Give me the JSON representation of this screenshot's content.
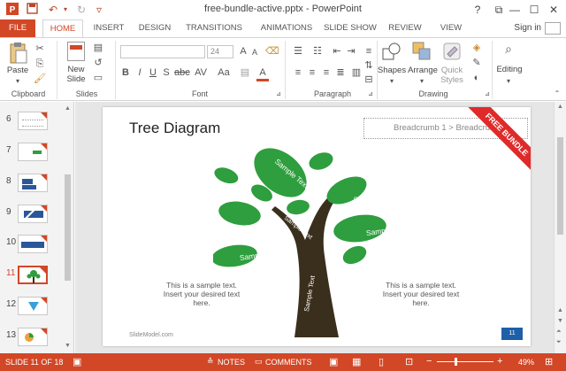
{
  "window": {
    "title": "free-bundle-active.pptx - PowerPoint"
  },
  "quick_access": {
    "save_icon": "save-icon",
    "undo_icon": "undo-icon",
    "redo_icon": "redo-icon",
    "customize_icon": "customize-icon"
  },
  "window_controls": {
    "help": "?",
    "restore": "⧉",
    "minimize": "—",
    "maximize": "☐",
    "close": "✕"
  },
  "tabs": [
    "FILE",
    "HOME",
    "INSERT",
    "DESIGN",
    "TRANSITIONS",
    "ANIMATIONS",
    "SLIDE SHOW",
    "REVIEW",
    "VIEW"
  ],
  "active_tab": "HOME",
  "sign_in": "Sign in",
  "ribbon": {
    "clipboard": {
      "paste": "Paste",
      "label": "Clipboard"
    },
    "slides": {
      "new_slide": "New",
      "new_slide2": "Slide",
      "label": "Slides"
    },
    "font": {
      "size": "24",
      "label": "Font"
    },
    "paragraph": {
      "label": "Paragraph"
    },
    "drawing": {
      "shapes": "Shapes",
      "arrange": "Arrange",
      "quick_styles": "Quick",
      "quick_styles2": "Styles",
      "label": "Drawing"
    },
    "editing": {
      "label": "Editing"
    }
  },
  "thumbnails": [
    {
      "num": "6"
    },
    {
      "num": "7"
    },
    {
      "num": "8"
    },
    {
      "num": "9"
    },
    {
      "num": "10"
    },
    {
      "num": "11",
      "selected": true
    },
    {
      "num": "12"
    },
    {
      "num": "13"
    }
  ],
  "slide": {
    "title": "Tree Diagram",
    "breadcrumb": "Breadcrumb 1 > Breadcrumb",
    "ribbon_text": "FREE BUNDLE",
    "leaves": [
      "Sample Text",
      "Sample Text",
      "Sample Text",
      "Sample Text"
    ],
    "branch_text": "Sample Text",
    "trunk_text": "Sample Text",
    "left_text": [
      "This is a sample text.",
      "Insert your desired text",
      "here."
    ],
    "right_text": [
      "This is a sample text.",
      "Insert your desired text",
      "here."
    ],
    "footer": "SlideModel.com",
    "page_num": "11"
  },
  "status": {
    "slide_info": "SLIDE 11 OF 18",
    "notes": "NOTES",
    "comments": "COMMENTS",
    "zoom": "49%"
  },
  "colors": {
    "accent": "#d24726",
    "leaf": "#2e9e3e",
    "trunk": "#3a2f1c",
    "ribbon_red": "#e02a2a"
  }
}
